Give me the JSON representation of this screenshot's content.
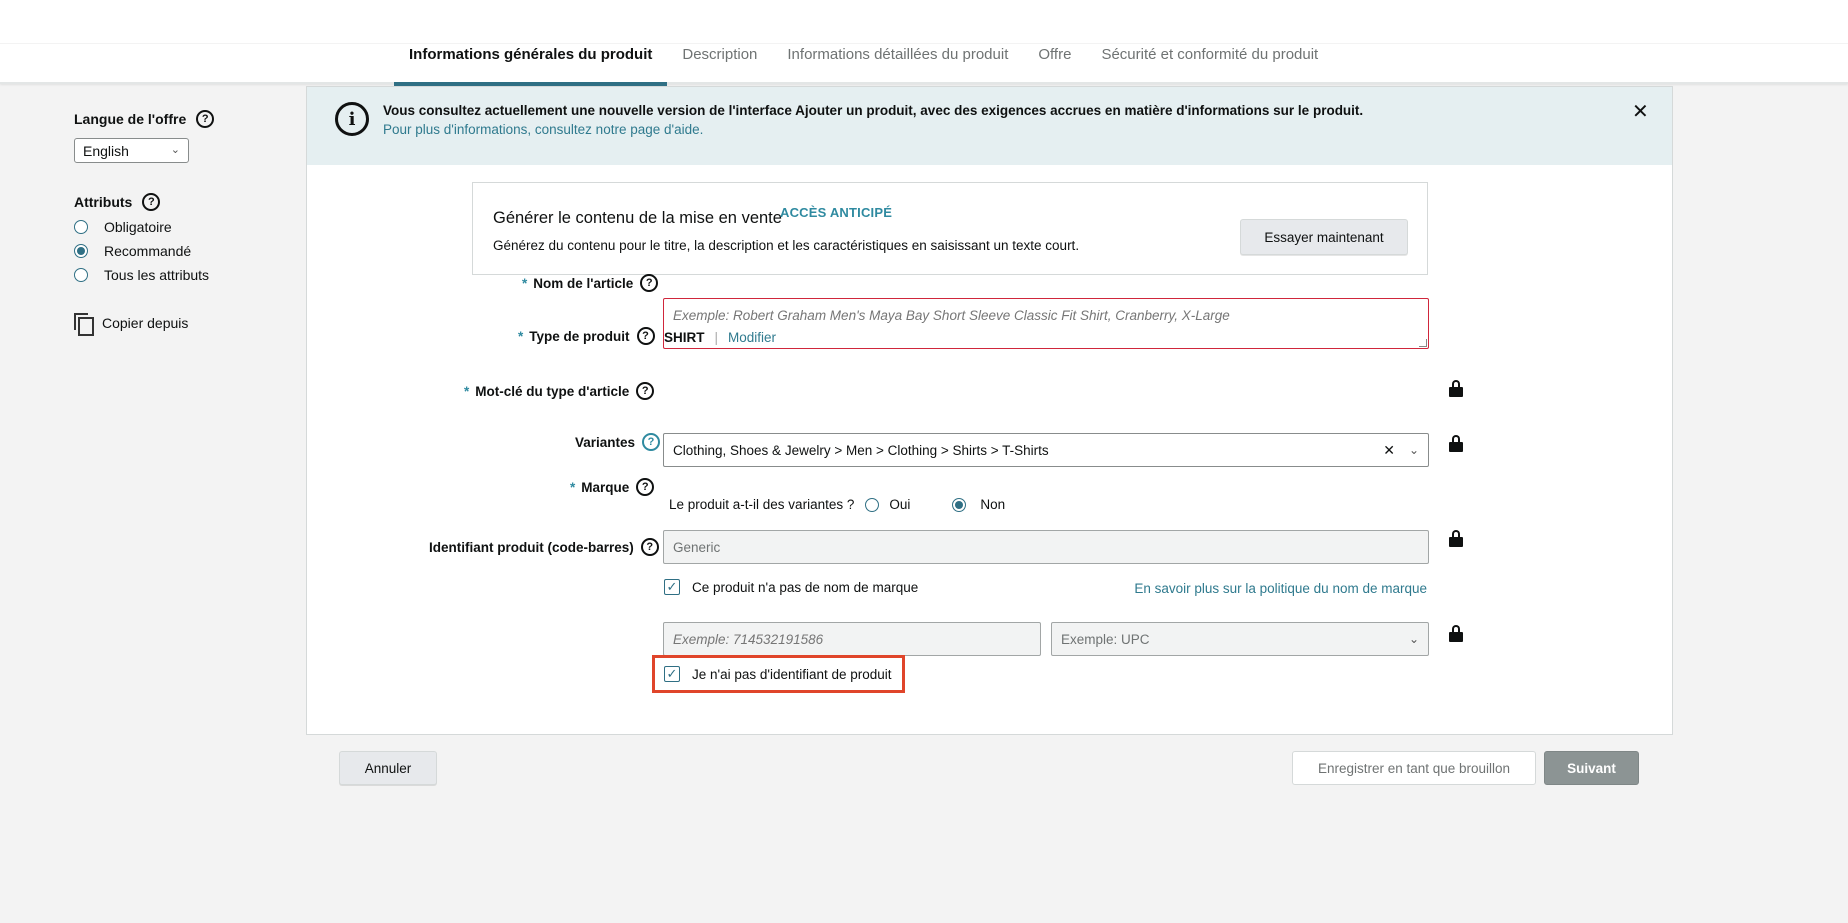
{
  "tabs": [
    {
      "label": "Informations générales du produit"
    },
    {
      "label": "Description"
    },
    {
      "label": "Informations détaillées du produit"
    },
    {
      "label": "Offre"
    },
    {
      "label": "Sécurité et conformité du produit"
    }
  ],
  "sidebar": {
    "lang_label": "Langue de l'offre",
    "lang_value": "English",
    "attributes_label": "Attributs",
    "attributes_options": [
      "Obligatoire",
      "Recommandé",
      "Tous les attributs"
    ],
    "attributes_selected": "Recommandé",
    "copy_label": "Copier depuis"
  },
  "banner": {
    "text": "Vous consultez actuellement une nouvelle version de l'interface Ajouter un produit, avec des exigences accrues en matière d'informations sur le produit.",
    "link": "Pour plus d'informations, consultez notre page d'aide."
  },
  "generate": {
    "title": "Générer le contenu de la mise en vente",
    "badge": "ACCÈS ANTICIPÉ",
    "subtitle": "Générez du contenu pour le titre, la description et les caractéristiques en saisissant un texte court.",
    "button": "Essayer maintenant"
  },
  "form": {
    "item_name_label": "Nom de l'article",
    "item_name_placeholder": "Exemple: Robert Graham Men's Maya Bay Short Sleeve Classic Fit Shirt, Cranberry, X-Large",
    "product_type_label": "Type de produit",
    "product_type_value": "SHIRT",
    "product_type_sep": "|",
    "product_type_modify": "Modifier",
    "keyword_label": "Mot-clé du type d'article",
    "keyword_value": "Clothing, Shoes & Jewelry > Men > Clothing > Shirts > T-Shirts",
    "variants_label": "Variantes",
    "variants_question": "Le produit a-t-il des variantes ?",
    "variants_yes": "Oui",
    "variants_no": "Non",
    "brand_label": "Marque",
    "brand_value": "Generic",
    "no_brand_label": "Ce produit n'a pas de nom de marque",
    "brand_policy_link": "En savoir plus sur la politique du nom de marque",
    "product_id_label": "Identifiant produit (code-barres)",
    "product_id_placeholder": "Exemple: 714532191586",
    "id_type_placeholder": "Exemple: UPC",
    "no_id_label": "Je n'ai pas d'identifiant de produit"
  },
  "footer": {
    "cancel": "Annuler",
    "save_draft": "Enregistrer en tant que brouillon",
    "next": "Suivant"
  },
  "colors": {
    "accent": "#2f6f84",
    "highlight_box": "#e0452a",
    "error_border": "#d0263b"
  }
}
